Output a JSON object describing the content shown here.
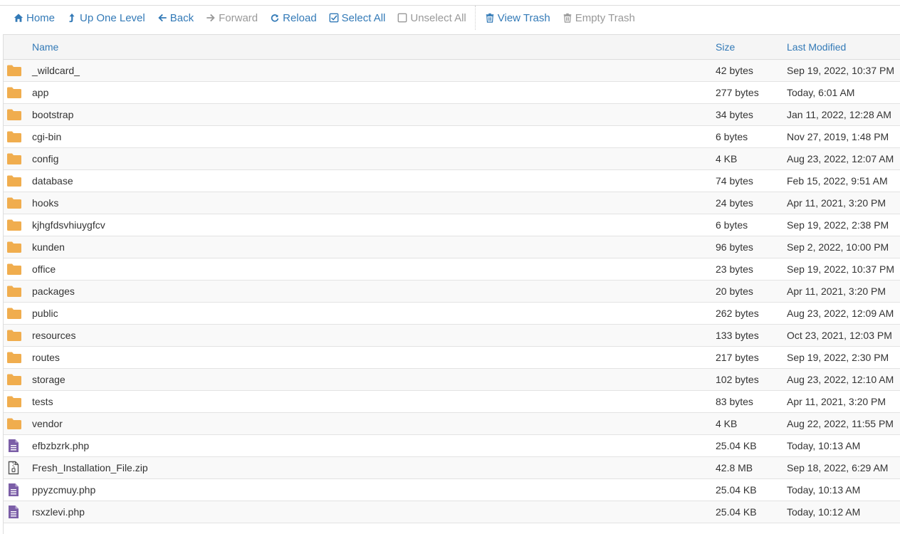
{
  "toolbar": {
    "buttons": [
      {
        "id": "home",
        "label": "Home",
        "icon": "home-icon",
        "disabled": false
      },
      {
        "id": "up",
        "label": "Up One Level",
        "icon": "level-up-icon",
        "disabled": false
      },
      {
        "id": "back",
        "label": "Back",
        "icon": "arrow-left-icon",
        "disabled": false
      },
      {
        "id": "forward",
        "label": "Forward",
        "icon": "arrow-right-icon",
        "disabled": true
      },
      {
        "id": "reload",
        "label": "Reload",
        "icon": "refresh-icon",
        "disabled": false
      },
      {
        "id": "select-all",
        "label": "Select All",
        "icon": "checked-box-icon",
        "disabled": false
      },
      {
        "id": "unselect-all",
        "label": "Unselect All",
        "icon": "empty-box-icon",
        "disabled": true
      },
      {
        "id": "view-trash",
        "label": "View Trash",
        "icon": "trash-icon",
        "disabled": false
      },
      {
        "id": "empty-trash",
        "label": "Empty Trash",
        "icon": "trash-icon",
        "disabled": true
      }
    ]
  },
  "table": {
    "columns": {
      "name": "Name",
      "size": "Size",
      "modified": "Last Modified"
    },
    "rows": [
      {
        "type": "folder",
        "name": "_wildcard_",
        "size": "42 bytes",
        "modified": "Sep 19, 2022, 10:37 PM"
      },
      {
        "type": "folder",
        "name": "app",
        "size": "277 bytes",
        "modified": "Today, 6:01 AM"
      },
      {
        "type": "folder",
        "name": "bootstrap",
        "size": "34 bytes",
        "modified": "Jan 11, 2022, 12:28 AM"
      },
      {
        "type": "folder",
        "name": "cgi-bin",
        "size": "6 bytes",
        "modified": "Nov 27, 2019, 1:48 PM"
      },
      {
        "type": "folder",
        "name": "config",
        "size": "4 KB",
        "modified": "Aug 23, 2022, 12:07 AM"
      },
      {
        "type": "folder",
        "name": "database",
        "size": "74 bytes",
        "modified": "Feb 15, 2022, 9:51 AM"
      },
      {
        "type": "folder",
        "name": "hooks",
        "size": "24 bytes",
        "modified": "Apr 11, 2021, 3:20 PM"
      },
      {
        "type": "folder",
        "name": "kjhgfdsvhiuygfcv",
        "size": "6 bytes",
        "modified": "Sep 19, 2022, 2:38 PM"
      },
      {
        "type": "folder",
        "name": "kunden",
        "size": "96 bytes",
        "modified": "Sep 2, 2022, 10:00 PM"
      },
      {
        "type": "folder",
        "name": "office",
        "size": "23 bytes",
        "modified": "Sep 19, 2022, 10:37 PM"
      },
      {
        "type": "folder",
        "name": "packages",
        "size": "20 bytes",
        "modified": "Apr 11, 2021, 3:20 PM"
      },
      {
        "type": "folder",
        "name": "public",
        "size": "262 bytes",
        "modified": "Aug 23, 2022, 12:09 AM"
      },
      {
        "type": "folder",
        "name": "resources",
        "size": "133 bytes",
        "modified": "Oct 23, 2021, 12:03 PM"
      },
      {
        "type": "folder",
        "name": "routes",
        "size": "217 bytes",
        "modified": "Sep 19, 2022, 2:30 PM"
      },
      {
        "type": "folder",
        "name": "storage",
        "size": "102 bytes",
        "modified": "Aug 23, 2022, 12:10 AM"
      },
      {
        "type": "folder",
        "name": "tests",
        "size": "83 bytes",
        "modified": "Apr 11, 2021, 3:20 PM"
      },
      {
        "type": "folder",
        "name": "vendor",
        "size": "4 KB",
        "modified": "Aug 22, 2022, 11:55 PM"
      },
      {
        "type": "php",
        "name": "efbzbzrk.php",
        "size": "25.04 KB",
        "modified": "Today, 10:13 AM"
      },
      {
        "type": "zip",
        "name": "Fresh_Installation_File.zip",
        "size": "42.8 MB",
        "modified": "Sep 18, 2022, 6:29 AM"
      },
      {
        "type": "php",
        "name": "ppyzcmuy.php",
        "size": "25.04 KB",
        "modified": "Today, 10:13 AM"
      },
      {
        "type": "php",
        "name": "rsxzlevi.php",
        "size": "25.04 KB",
        "modified": "Today, 10:12 AM"
      }
    ]
  },
  "colors": {
    "link": "#337ab7",
    "disabled": "#999999",
    "folder": "#f0ad4e",
    "php_file": "#7b5ea7",
    "zip_file": "#555555",
    "header_bg": "#f5f5f5",
    "stripe": "#f9f9f9"
  }
}
